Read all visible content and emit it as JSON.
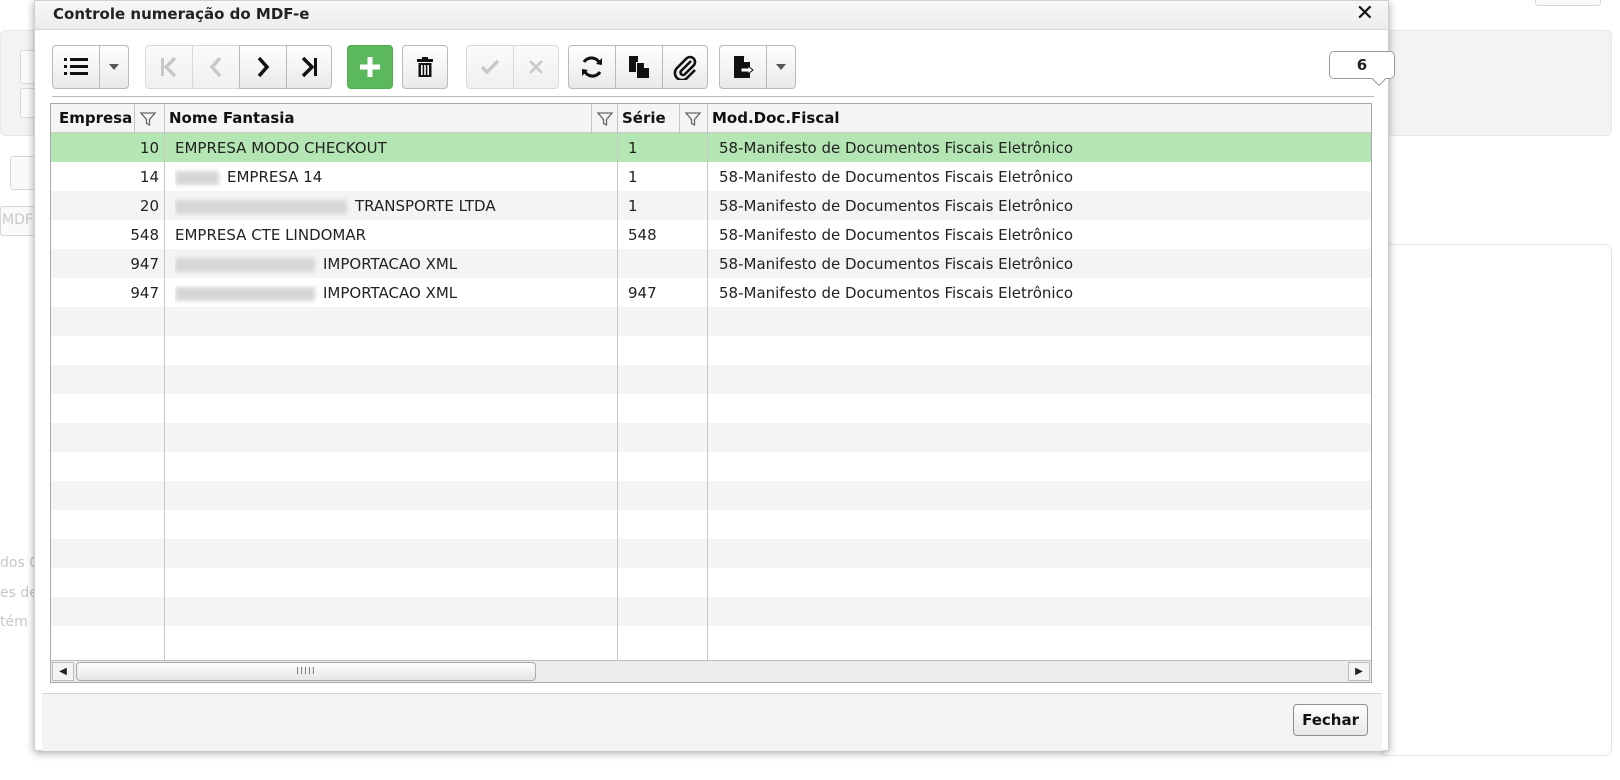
{
  "background": {
    "tab_label": "MDF",
    "faded_lines": [
      "dos C",
      "es de",
      "tém"
    ]
  },
  "dialog": {
    "title": "Controle numeração do MDF-e",
    "close_icon": "close-icon",
    "record_count": "6",
    "footer": {
      "close_label": "Fechar"
    }
  },
  "toolbar": {
    "buttons": [
      {
        "name": "list-view-button",
        "icon": "list-icon",
        "enabled": true
      },
      {
        "name": "list-view-dropdown",
        "icon": "caret-down-icon",
        "enabled": true
      },
      {
        "name": "first-record-button",
        "icon": "first-icon",
        "enabled": false
      },
      {
        "name": "previous-record-button",
        "icon": "chevron-left-icon",
        "enabled": false
      },
      {
        "name": "next-record-button",
        "icon": "chevron-right-icon",
        "enabled": true
      },
      {
        "name": "last-record-button",
        "icon": "last-icon",
        "enabled": true
      },
      {
        "name": "add-button",
        "icon": "plus-icon",
        "enabled": true
      },
      {
        "name": "delete-button",
        "icon": "trash-icon",
        "enabled": true
      },
      {
        "name": "confirm-button",
        "icon": "check-icon",
        "enabled": false
      },
      {
        "name": "cancel-button",
        "icon": "x-icon",
        "enabled": false
      },
      {
        "name": "refresh-button",
        "icon": "refresh-icon",
        "enabled": true
      },
      {
        "name": "duplicate-button",
        "icon": "copy-icon",
        "enabled": true
      },
      {
        "name": "attach-button",
        "icon": "paperclip-icon",
        "enabled": true
      },
      {
        "name": "export-button",
        "icon": "export-file-icon",
        "enabled": true
      },
      {
        "name": "export-dropdown",
        "icon": "caret-down-icon",
        "enabled": true
      }
    ],
    "accent_green": "#5cb85c"
  },
  "grid": {
    "columns": [
      "Empresa",
      "Nome Fantasia",
      "Série",
      "Mod.Doc.Fiscal"
    ],
    "selected_row_color": "#b4e6b3",
    "rows": [
      {
        "empresa": "10",
        "nome": "EMPRESA MODO CHECKOUT",
        "serie": "1",
        "mod": "58-Manifesto de Documentos Fiscais Eletrônico"
      },
      {
        "empresa": "14",
        "nome": "EMPRESA 14",
        "serie": "1",
        "mod": "58-Manifesto de Documentos Fiscais Eletrônico"
      },
      {
        "empresa": "20",
        "nome": "TRANSPORTE LTDA",
        "serie": "1",
        "mod": "58-Manifesto de Documentos Fiscais Eletrônico"
      },
      {
        "empresa": "548",
        "nome": "EMPRESA CTE LINDOMAR",
        "serie": "548",
        "mod": "58-Manifesto de Documentos Fiscais Eletrônico"
      },
      {
        "empresa": "947",
        "nome": "IMPORTACAO XML",
        "serie": "",
        "mod": "58-Manifesto de Documentos Fiscais Eletrônico"
      },
      {
        "empresa": "947",
        "nome": "IMPORTACAO XML",
        "serie": "947",
        "mod": "58-Manifesto de Documentos Fiscais Eletrônico"
      }
    ],
    "scrollbar_grip": "IIIII"
  }
}
